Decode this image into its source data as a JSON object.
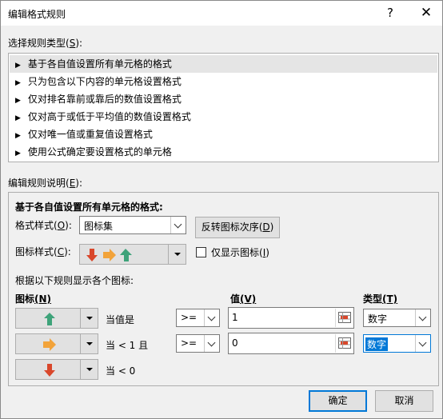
{
  "window": {
    "title": "编辑格式规则",
    "help_glyph": "?",
    "close_glyph": "✕"
  },
  "rule_type": {
    "label_prefix": "选择规则类型(",
    "label_key": "S",
    "label_suffix": "):",
    "items": [
      {
        "label": "基于各自值设置所有单元格的格式"
      },
      {
        "label": "只为包含以下内容的单元格设置格式"
      },
      {
        "label": "仅对排名靠前或靠后的数值设置格式"
      },
      {
        "label": "仅对高于或低于平均值的数值设置格式"
      },
      {
        "label": "仅对唯一值或重复值设置格式"
      },
      {
        "label": "使用公式确定要设置格式的单元格"
      }
    ],
    "arrow_glyph": "▶"
  },
  "description": {
    "label_prefix": "编辑规则说明(",
    "label_key": "E",
    "label_suffix": "):",
    "heading": "基于各自值设置所有单元格的格式:",
    "format_style": {
      "label_prefix": "格式样式(",
      "label_key": "O",
      "label_suffix": "):",
      "value": "图标集"
    },
    "reverse_button": {
      "label_prefix": "反转图标次序(",
      "label_key": "D",
      "label_suffix": ")"
    },
    "icon_style": {
      "label_prefix": "图标样式(",
      "label_key": "C",
      "label_suffix": "):",
      "icons": [
        "red-down-arrow-icon",
        "yellow-right-arrow-icon",
        "green-up-arrow-icon"
      ]
    },
    "show_icon_only": {
      "label_prefix": "仅显示图标(",
      "label_key": "I",
      "label_suffix": ")",
      "checked": false
    },
    "rules_caption": "根据以下规则显示各个图标:",
    "columns": {
      "icon_prefix": "图标",
      "icon_key": "(N)",
      "value_prefix": "值",
      "value_key": "(V)",
      "type_prefix": "类型",
      "type_key": "(T)"
    },
    "rules": [
      {
        "icon": "green-up-arrow-icon",
        "condition": "当值是",
        "operator": ">=",
        "value": "1",
        "type": "数字"
      },
      {
        "icon": "yellow-right-arrow-icon",
        "condition": "当 < 1 且",
        "operator": ">=",
        "value": "0",
        "type": "数字"
      },
      {
        "icon": "red-down-arrow-icon",
        "condition": "当 < 0"
      }
    ]
  },
  "footer": {
    "ok": "确定",
    "cancel": "取消"
  },
  "colors": {
    "green_arrow": "#3ea37a",
    "yellow_arrow": "#f2a33a",
    "red_arrow": "#d9472b",
    "selection_blue": "#0078d7"
  }
}
